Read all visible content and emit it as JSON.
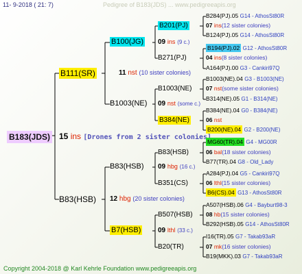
{
  "header": {
    "date": "11-  9-2018 (  21:  7)",
    "watermark": "Pedigree of B183(JDS) ... www.pedigreeapis.org"
  },
  "footer": {
    "copyright": "Copyright 2004-2018 @ Karl Kehrle Foundation    www.pedigreeapis.org"
  },
  "root": {
    "id": "B183(JDS)",
    "year": "15",
    "code": "ins",
    "note": "[Drones from 2 sister colonies]"
  },
  "gen1": [
    {
      "id": "B111(SR)",
      "year": "11",
      "code": "nst",
      "note": "(10 sister colonies)"
    },
    {
      "id": "B83(HSB)",
      "year": "12",
      "code": "hbg",
      "note": "(20 sister colonies)"
    }
  ],
  "gen2": [
    {
      "id": "B100(JG)",
      "year": "09",
      "code": "ins",
      "note": "(9 c.)"
    },
    {
      "id": "B1003(NE)",
      "year": "09",
      "code": "nst",
      "note": "(some c.)"
    },
    {
      "id": "B83(HSB)",
      "year": "09",
      "code": "hbg",
      "note": "(16 c.)"
    },
    {
      "id": "B7(HSB)",
      "year": "09",
      "code": "lthl",
      "note": "(33 c.)"
    }
  ],
  "gen3": [
    {
      "id": "B201(PJ)",
      "year": "07",
      "code": "ins",
      "note": "(12 sister colonies)"
    },
    {
      "id": "B271(PJ)",
      "year": "04",
      "code": "ins",
      "note": "(8 sister colonies)"
    },
    {
      "id": "B1003(NE)",
      "year": "07",
      "code": "nst",
      "note": "(some sister colonies)"
    },
    {
      "id": "B384(NE)",
      "year": "06",
      "code": "nst",
      "note": ""
    },
    {
      "id": "B83(HSB)",
      "year": "06",
      "code": "bal",
      "note": "(18 sister colonies)"
    },
    {
      "id": "B351(CS)",
      "year": "06",
      "code": "lthl",
      "note": "(15 sister colonies)"
    },
    {
      "id": "B507(HSB)",
      "year": "08",
      "code": "hb",
      "note": "(15 sister colonies)"
    },
    {
      "id": "B20(TR)",
      "year": "07",
      "code": "mk",
      "note": "(16 sister colonies)"
    }
  ],
  "gen4": [
    {
      "id": "B284(PJ).05",
      "tag": "G14 - AthosSt80R"
    },
    {
      "id": "B124(PJ).05",
      "tag": "G14 - AthosSt80R"
    },
    {
      "id": "B194(PJ).02",
      "tag": "G12 - AthosSt80R"
    },
    {
      "id": "A164(PJ).00",
      "tag": "G3 - Cankiri97Q"
    },
    {
      "id": "B1003(NE).04",
      "tag": "G3 - B1003(NE)"
    },
    {
      "id": "B314(NE).05",
      "tag": "G1 - B314(NE)"
    },
    {
      "id": "B384(NE).04",
      "tag": "G0 - B384(NE)"
    },
    {
      "id": "B200(NE).04",
      "tag": "G2 - B200(NE)"
    },
    {
      "id": "MG60(TR).04",
      "tag": "G4 - MG00R"
    },
    {
      "id": "B77(TR).04",
      "tag": "G8 - Old_Lady"
    },
    {
      "id": "A284(PJ).04",
      "tag": "G5 - Cankiri97Q"
    },
    {
      "id": "B6(CS).04",
      "tag": "G13 - AthosSt80R"
    },
    {
      "id": "A507(HSB).06",
      "tag": "G4 - Bayburt98-3"
    },
    {
      "id": "B292(HSB).05",
      "tag": "G14 - AthosSt80R"
    },
    {
      "id": "I16(TR).05",
      "tag": "G7 - Takab93aR"
    },
    {
      "id": "B19(MKK).03",
      "tag": "G7 - Takab93aR"
    }
  ]
}
